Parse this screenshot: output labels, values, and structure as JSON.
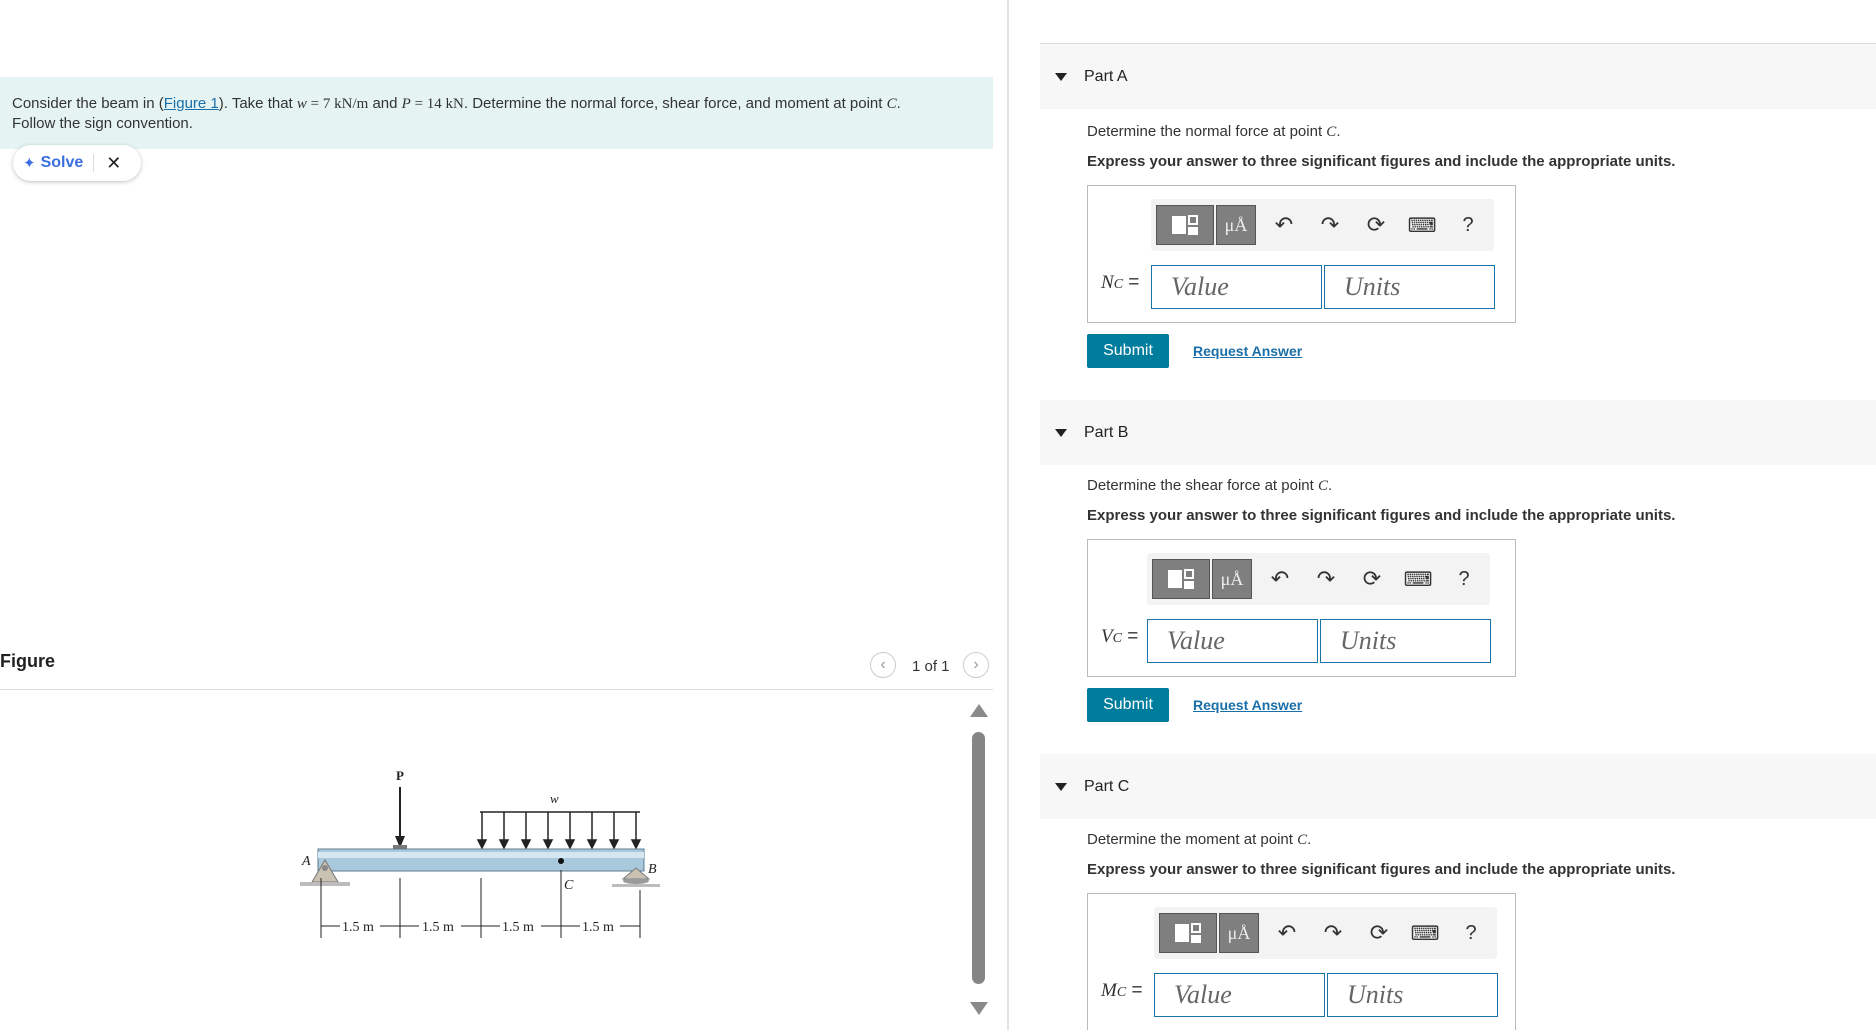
{
  "problem": {
    "text_1": "Consider the beam in (",
    "figure_link": "Figure 1",
    "text_2": "). Take that ",
    "w_sym": "w",
    "w_val": " = 7 kN/m",
    "text_3": " and ",
    "p_sym": "P",
    "p_val": " = 14 kN",
    "text_4": ". Determine the normal force, shear force, and moment at point ",
    "c_sym": "C",
    "text_5": ".",
    "text_6": "Follow the sign convention."
  },
  "solve_chip": {
    "icon": "sparkle-icon",
    "label": "Solve",
    "close": "✕"
  },
  "figure": {
    "title": "Figure",
    "page": "1 of 1",
    "labels": {
      "P": "P",
      "w": "w",
      "A": "A",
      "B": "B",
      "C": "C"
    },
    "dims": [
      "1.5 m",
      "1.5 m",
      "1.5 m",
      "1.5 m"
    ]
  },
  "parts": [
    {
      "label": "Part A",
      "question_prefix": "Determine the normal force at point ",
      "question_sym": "C",
      "question_suffix": ".",
      "instruction": "Express your answer to three significant figures and include the appropriate units.",
      "var_main": "N",
      "var_sub": "C",
      "value_placeholder": "Value",
      "units_placeholder": "Units",
      "submit": "Submit",
      "request": "Request Answer"
    },
    {
      "label": "Part B",
      "question_prefix": "Determine the shear force at point ",
      "question_sym": "C",
      "question_suffix": ".",
      "instruction": "Express your answer to three significant figures and include the appropriate units.",
      "var_main": "V",
      "var_sub": "C",
      "value_placeholder": "Value",
      "units_placeholder": "Units",
      "submit": "Submit",
      "request": "Request Answer"
    },
    {
      "label": "Part C",
      "question_prefix": "Determine the moment at point ",
      "question_sym": "C",
      "question_suffix": ".",
      "instruction": "Express your answer to three significant figures and include the appropriate units.",
      "var_main": "M",
      "var_sub": "C",
      "value_placeholder": "Value",
      "units_placeholder": "Units"
    }
  ],
  "toolbar": {
    "mu_label": "μÅ",
    "help": "?",
    "icons": [
      "templates-icon",
      "units-icon",
      "undo-icon",
      "redo-icon",
      "reset-icon",
      "keyboard-icon",
      "help-icon"
    ]
  },
  "colors": {
    "prompt_bg": "#e5f4f3",
    "submit_bg": "#007c9c",
    "link": "#1a6fa8",
    "field_border": "#1a73a8"
  }
}
